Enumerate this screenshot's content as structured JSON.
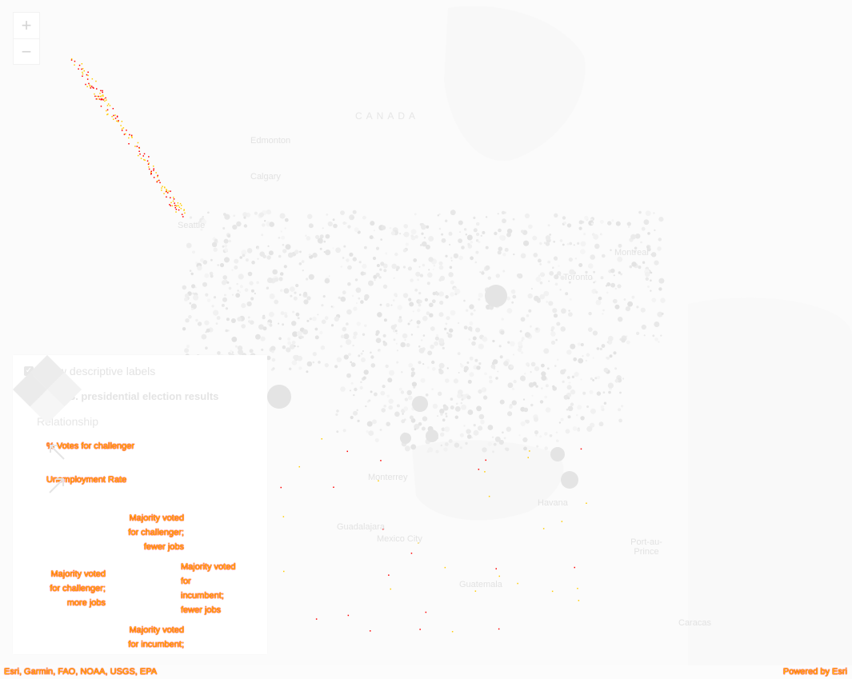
{
  "zoom": {
    "in_label": "+",
    "out_label": "−"
  },
  "places": [
    {
      "name": "CANADA",
      "kind": "country"
    },
    {
      "name": "Edmonton",
      "kind": "city"
    },
    {
      "name": "Calgary",
      "kind": "city"
    },
    {
      "name": "Seattle",
      "kind": "city"
    },
    {
      "name": "Montreal",
      "kind": "city"
    },
    {
      "name": "Toronto",
      "kind": "city"
    },
    {
      "name": "Monterrey",
      "kind": "city"
    },
    {
      "name": "Havana",
      "kind": "city"
    },
    {
      "name": "Guadalajara",
      "kind": "city"
    },
    {
      "name": "Mexico City",
      "kind": "city"
    },
    {
      "name": "Guatemala",
      "kind": "city"
    },
    {
      "name": "Port-au-Prince",
      "kind": "city"
    },
    {
      "name": "Caracas",
      "kind": "city"
    }
  ],
  "legend": {
    "checkbox_checked": true,
    "checkbox_label": "Show descriptive labels",
    "title": "2012 U.S. presidential election results",
    "subtitle": "Relationship",
    "arrow_labels": [
      "% Votes for challenger",
      "Unemployment Rate"
    ],
    "corners": {
      "top": [
        "Majority voted",
        "for challenger;",
        "fewer jobs"
      ],
      "left": [
        "Majority voted",
        "for challenger;",
        "more jobs"
      ],
      "right": [
        "Majority voted",
        "for",
        "incumbent;",
        "fewer jobs"
      ],
      "bottom": [
        "Majority voted",
        "for incumbent;"
      ]
    },
    "diamond_colors": [
      "#ececec",
      "#f2f2f2",
      "#f6f6f6",
      "#ebebeb"
    ]
  },
  "attribution": {
    "sources": "Esri, Garmin, FAO, NOAA, USGS, EPA",
    "powered_by": "Powered by Esri"
  },
  "colors": {
    "land": "#fbfbfb",
    "highlight_text": "#ffcc00",
    "highlight_outline": "#ff0000",
    "dots": "#e8e8e8"
  }
}
